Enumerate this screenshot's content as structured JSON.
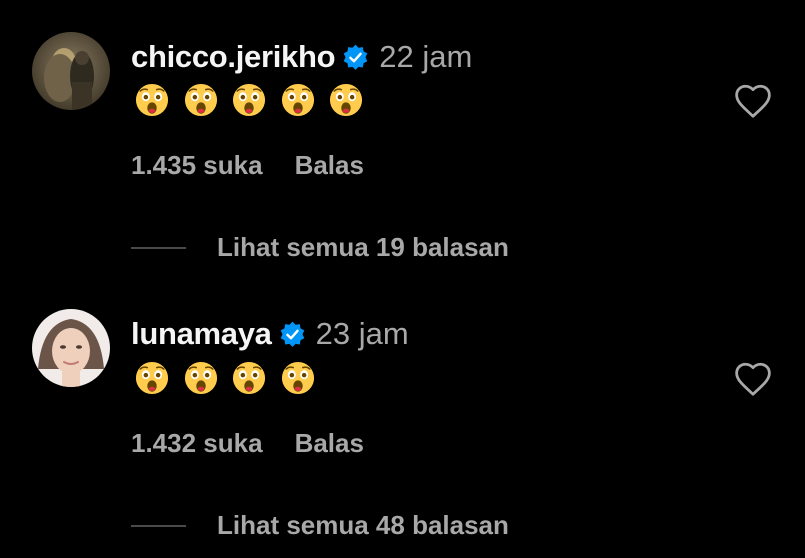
{
  "comments": [
    {
      "username": "chicco.jerikho",
      "verified": true,
      "time": "22 jam",
      "emoji_count": 5,
      "emoji_name": "astonished-face-icon",
      "likes": "1.435 suka",
      "reply_label": "Balas",
      "view_replies": "Lihat semua 19 balasan"
    },
    {
      "username": "lunamaya",
      "verified": true,
      "time": "23 jam",
      "emoji_count": 4,
      "emoji_name": "astonished-face-icon",
      "likes": "1.432 suka",
      "reply_label": "Balas",
      "view_replies": "Lihat semua 48 balasan"
    }
  ],
  "colors": {
    "background": "#000000",
    "primary_text": "#f5f5f5",
    "secondary_text": "#a8a8a8",
    "verified_badge": "#0095f6"
  }
}
